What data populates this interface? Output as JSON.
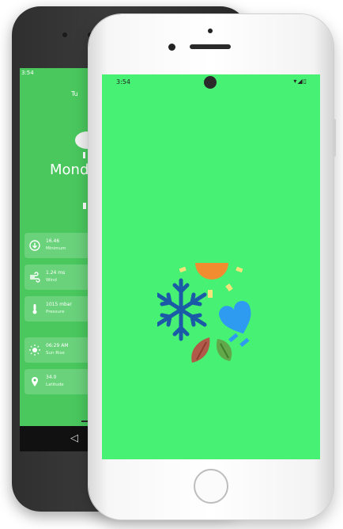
{
  "android": {
    "status_time": "3:54",
    "top_date": "Tu",
    "city": "Mondo",
    "cards": [
      {
        "value": "16.46",
        "label": "Minimum",
        "icon": "down-arrow-circle-icon"
      },
      {
        "value": "1.24 ms",
        "label": "Wind",
        "icon": "wind-icon"
      },
      {
        "value": "1015 mbar",
        "label": "Pressure",
        "icon": "thermometer-icon"
      },
      {
        "value": "06:29 AM",
        "label": "Sun Rise",
        "icon": "sun-icon"
      },
      {
        "value": "34.0",
        "label": "Latitude",
        "icon": "location-pin-icon"
      }
    ]
  },
  "iphone": {
    "status_time": "3:54",
    "status_icons": "▾◢▯"
  },
  "colors": {
    "android_screen": "#4ac85e",
    "iphone_screen": "#46f173",
    "sun": "#f28c30",
    "snowflake": "#1a5aa6",
    "heart": "#2f9bf0"
  }
}
